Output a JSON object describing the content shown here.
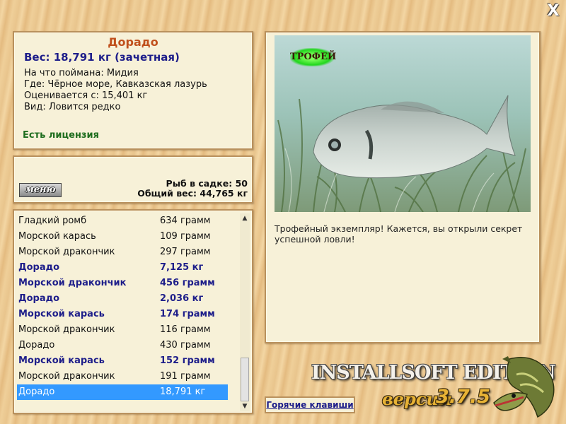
{
  "window": {
    "close_label": "X"
  },
  "fish_info": {
    "name": "Дорадо",
    "weight": "Вес: 18,791 кг (зачетная)",
    "bait": "На что поймана: Мидия",
    "location": "Где: Чёрное море, Кавказская лазурь",
    "min_weight": "Оценивается с: 15,401 кг",
    "rarity": "Вид: Ловится редко",
    "license": "Есть лицензия"
  },
  "stats": {
    "menu_label": "меню",
    "fish_in_keepnet": "Рыб в садке: 50",
    "total_weight": "Общий вес: 44,765 кг"
  },
  "catch_list": [
    {
      "name": "Гладкий ромб",
      "weight": "634 грамм",
      "bold": false,
      "selected": false
    },
    {
      "name": "Морской карась",
      "weight": "109 грамм",
      "bold": false,
      "selected": false
    },
    {
      "name": "Морской дракончик",
      "weight": "297 грамм",
      "bold": false,
      "selected": false
    },
    {
      "name": "Дорадо",
      "weight": "7,125 кг",
      "bold": true,
      "selected": false
    },
    {
      "name": "Морской дракончик",
      "weight": "456 грамм",
      "bold": true,
      "selected": false
    },
    {
      "name": "Дорадо",
      "weight": "2,036 кг",
      "bold": true,
      "selected": false
    },
    {
      "name": "Морской карась",
      "weight": "174 грамм",
      "bold": true,
      "selected": false
    },
    {
      "name": "Морской дракончик",
      "weight": "116 грамм",
      "bold": false,
      "selected": false
    },
    {
      "name": "Дорадо",
      "weight": "430 грамм",
      "bold": false,
      "selected": false
    },
    {
      "name": "Морской карась",
      "weight": "152 грамм",
      "bold": true,
      "selected": false
    },
    {
      "name": "Морской дракончик",
      "weight": "191 грамм",
      "bold": false,
      "selected": false
    },
    {
      "name": "Дорадо",
      "weight": "18,791 кг",
      "bold": false,
      "selected": true
    }
  ],
  "photo": {
    "trophy_badge": "ТРОФЕЙ",
    "description": "Трофейный экземпляр! Кажется, вы открыли секрет успешной ловли!"
  },
  "hotkeys_label": "Горячие клавиши",
  "branding": {
    "edition": "INSTALLSOFT EDITION",
    "version_label": "версия",
    "version_number": "3.7.5"
  },
  "colors": {
    "title": "#c0501c",
    "bold_text": "#1e1e8a",
    "license": "#1f6e1f",
    "selection": "#3399ff",
    "panel_bg": "#f7f1d8"
  }
}
